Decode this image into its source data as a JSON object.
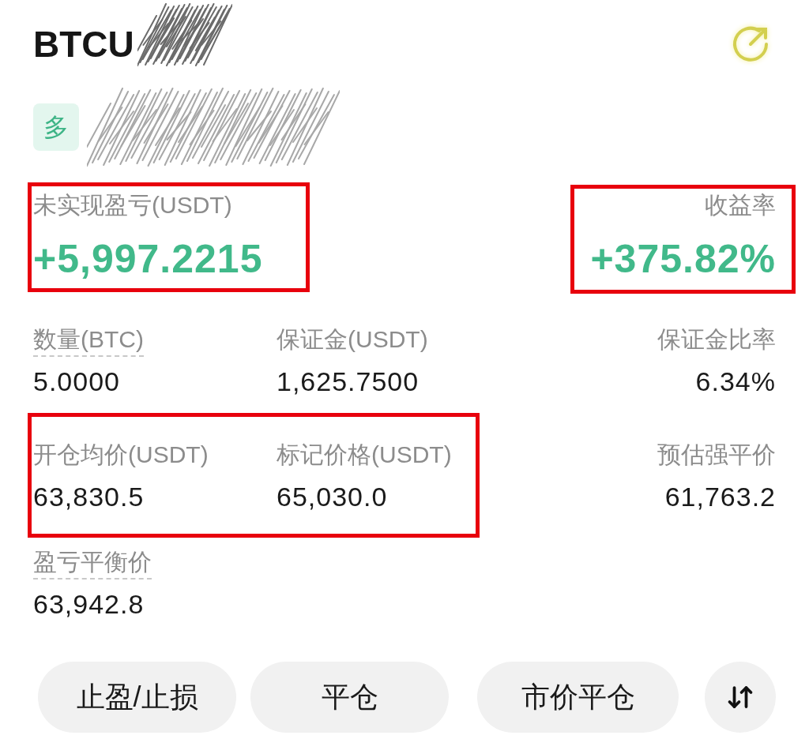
{
  "header": {
    "title": "BTCU",
    "redacted": true
  },
  "position": {
    "side": {
      "label": "多",
      "kind": "long"
    },
    "redacted": true
  },
  "pnl": {
    "label": "未实现盈亏(USDT)",
    "value": "+5,997.2215",
    "highlighted": true
  },
  "roi": {
    "label": "收益率",
    "value": "+375.82%",
    "highlighted": true
  },
  "rows": [
    {
      "highlighted": false,
      "cells": [
        {
          "label": "数量(BTC)",
          "value": "5.0000",
          "underlined": true
        },
        {
          "label": "保证金(USDT)",
          "value": "1,625.7500",
          "underlined": false
        }
      ],
      "end_cell": {
        "label": "保证金比率",
        "value": "6.34%",
        "underlined": false
      }
    },
    {
      "highlighted": true,
      "cells": [
        {
          "label": "开仓均价(USDT)",
          "value": "63,830.5",
          "underlined": false
        },
        {
          "label": "标记价格(USDT)",
          "value": "65,030.0",
          "underlined": false
        }
      ],
      "end_cell": {
        "label": "预估强平价",
        "value": "61,763.2",
        "underlined": false
      }
    },
    {
      "highlighted": false,
      "cells": [
        {
          "label": "盈亏平衡价",
          "value": "63,942.8",
          "underlined": true
        }
      ]
    }
  ],
  "actions": [
    "止盈/止损",
    "平仓",
    "市价平仓"
  ]
}
